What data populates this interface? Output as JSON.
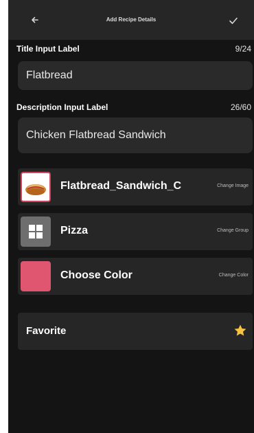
{
  "header": {
    "title": "Add Recipe Details",
    "back_icon": "arrow-left-icon",
    "confirm_icon": "checkmark-icon"
  },
  "title_field": {
    "label": "Title Input Label",
    "counter": "9/24",
    "value": "Flatbread"
  },
  "description_field": {
    "label": "Description Input Label",
    "counter": "26/60",
    "value": "Chicken Flatbread Sandwich"
  },
  "image_row": {
    "label": "Flatbread_Sandwich_C",
    "action": "Change Image",
    "thumb_icon": "sandwich-image"
  },
  "group_row": {
    "label": "Pizza",
    "action": "Change Group",
    "thumb_icon": "grid-icon"
  },
  "color_row": {
    "label": "Choose Color",
    "action": "Change Color",
    "swatch_color": "#e0556f"
  },
  "favorite_row": {
    "label": "Favorite",
    "icon": "star-icon",
    "star_color": "#f5c242"
  }
}
